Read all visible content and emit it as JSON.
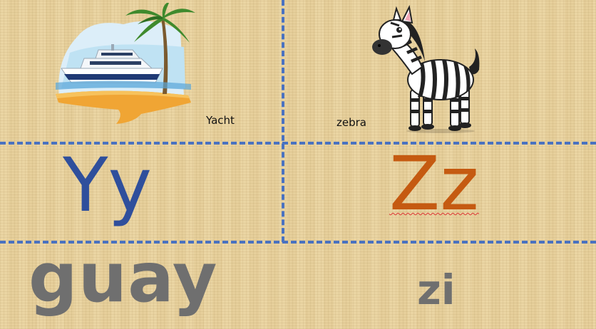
{
  "cards": {
    "y": {
      "word": "Yacht",
      "letters": "Yy",
      "pronunciation": "guay",
      "letter_color": "#2f4f9c"
    },
    "z": {
      "word": "zebra",
      "letters": "Zz",
      "pronunciation": "zi",
      "letter_color": "#c55a11"
    }
  },
  "icons": {
    "yacht": "yacht-palm-illustration",
    "zebra": "zebra-illustration"
  },
  "colors": {
    "background": "#e6cf9b",
    "divider": "#4a72c0",
    "pronunciation": "#6f6f6f"
  }
}
